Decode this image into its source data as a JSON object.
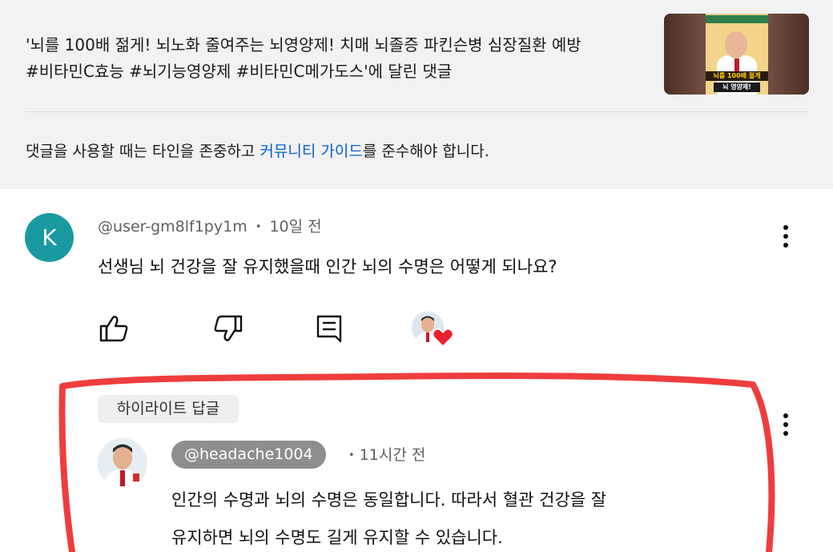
{
  "video": {
    "title_line1": "'뇌를 100배 젊게! 뇌노화 줄여주는 뇌영양제! 치매 뇌졸증 파킨슨병 심장질환 예방",
    "title_line2": "#비타민C효능 #뇌기능영양제 #비타민C메가도스'에 달린 댓글",
    "thumbnail_caption_1": "뇌를 100배 젊게",
    "thumbnail_caption_2": "뇌 영양제!"
  },
  "guidelines": {
    "prefix": "댓글을 사용할 때는 타인을 존중하고 ",
    "link_label": "커뮤니티 가이드",
    "suffix": "를 준수해야 합니다."
  },
  "comment": {
    "avatar_letter": "K",
    "author": "@user-gm8lf1py1m",
    "separator": "•",
    "time": "10일 전",
    "text": "선생님 뇌 건강을 잘 유지했을때 인간 뇌의 수명은 어떻게 되나요?",
    "icons": [
      "thumbs-up-icon",
      "thumbs-down-icon",
      "reply-icon",
      "creator-heart-icon",
      "more-vert-icon"
    ]
  },
  "highlighted_reply": {
    "badge": "하이라이트 답글",
    "author": "@headache1004",
    "separator": "•",
    "time": "11시간 전",
    "text_line1": "인간의 수명과 뇌의 수명은 동일합니다. 따라서 혈관 건강을 잘",
    "text_line2": "유지하면 뇌의 수명도 길게 유지할 수 있습니다."
  },
  "colors": {
    "header_bg": "#f2f2f2",
    "link": "#065fd4",
    "avatar_k": "#1a9aa0",
    "handle_chip": "#8e8e8e",
    "heart": "#e8202c",
    "annotation": "#ee3333"
  }
}
